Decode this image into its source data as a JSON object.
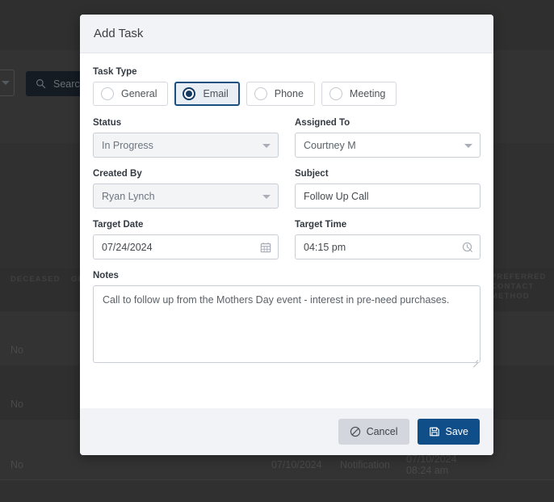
{
  "background": {
    "search": {
      "placeholder": "Search...",
      "icon": "search-icon"
    },
    "filter_dropdown": {
      "icon": "chevron-down-icon"
    },
    "table": {
      "columns": [
        "DECEASED",
        "GE",
        "PREFERRED",
        "CONTACT",
        "METHOD"
      ],
      "rows": [
        {
          "deceased": "No"
        },
        {
          "deceased": "No"
        },
        {
          "deceased": "No",
          "date": "07/10/2024",
          "type": "Notification",
          "timestamp_date": "07/10/2024",
          "timestamp_time": "08:24 am"
        }
      ]
    }
  },
  "modal": {
    "title": "Add Task",
    "task_type": {
      "label": "Task Type",
      "options": [
        {
          "label": "General",
          "selected": false
        },
        {
          "label": "Email",
          "selected": true
        },
        {
          "label": "Phone",
          "selected": false
        },
        {
          "label": "Meeting",
          "selected": false
        }
      ]
    },
    "fields": {
      "status": {
        "label": "Status",
        "value": "In Progress",
        "icon": "chevron-down-icon"
      },
      "assigned_to": {
        "label": "Assigned To",
        "value": "Courtney M",
        "icon": "chevron-down-icon"
      },
      "created_by": {
        "label": "Created By",
        "value": "Ryan Lynch",
        "icon": "chevron-down-icon"
      },
      "subject": {
        "label": "Subject",
        "value": "Follow Up Call"
      },
      "target_date": {
        "label": "Target Date",
        "value": "07/24/2024",
        "icon": "calendar-icon"
      },
      "target_time": {
        "label": "Target Time",
        "value": "04:15 pm",
        "icon": "clock-icon"
      },
      "notes": {
        "label": "Notes",
        "value": "Call to follow up from the Mothers Day event - interest in pre-need purchases."
      }
    },
    "footer": {
      "cancel_label": "Cancel",
      "save_label": "Save"
    }
  },
  "colors": {
    "accent": "#104e89",
    "selected_radio": "#123a63",
    "header_bg": "#f1f3f7",
    "cancel_bg": "#d3d6dc"
  }
}
